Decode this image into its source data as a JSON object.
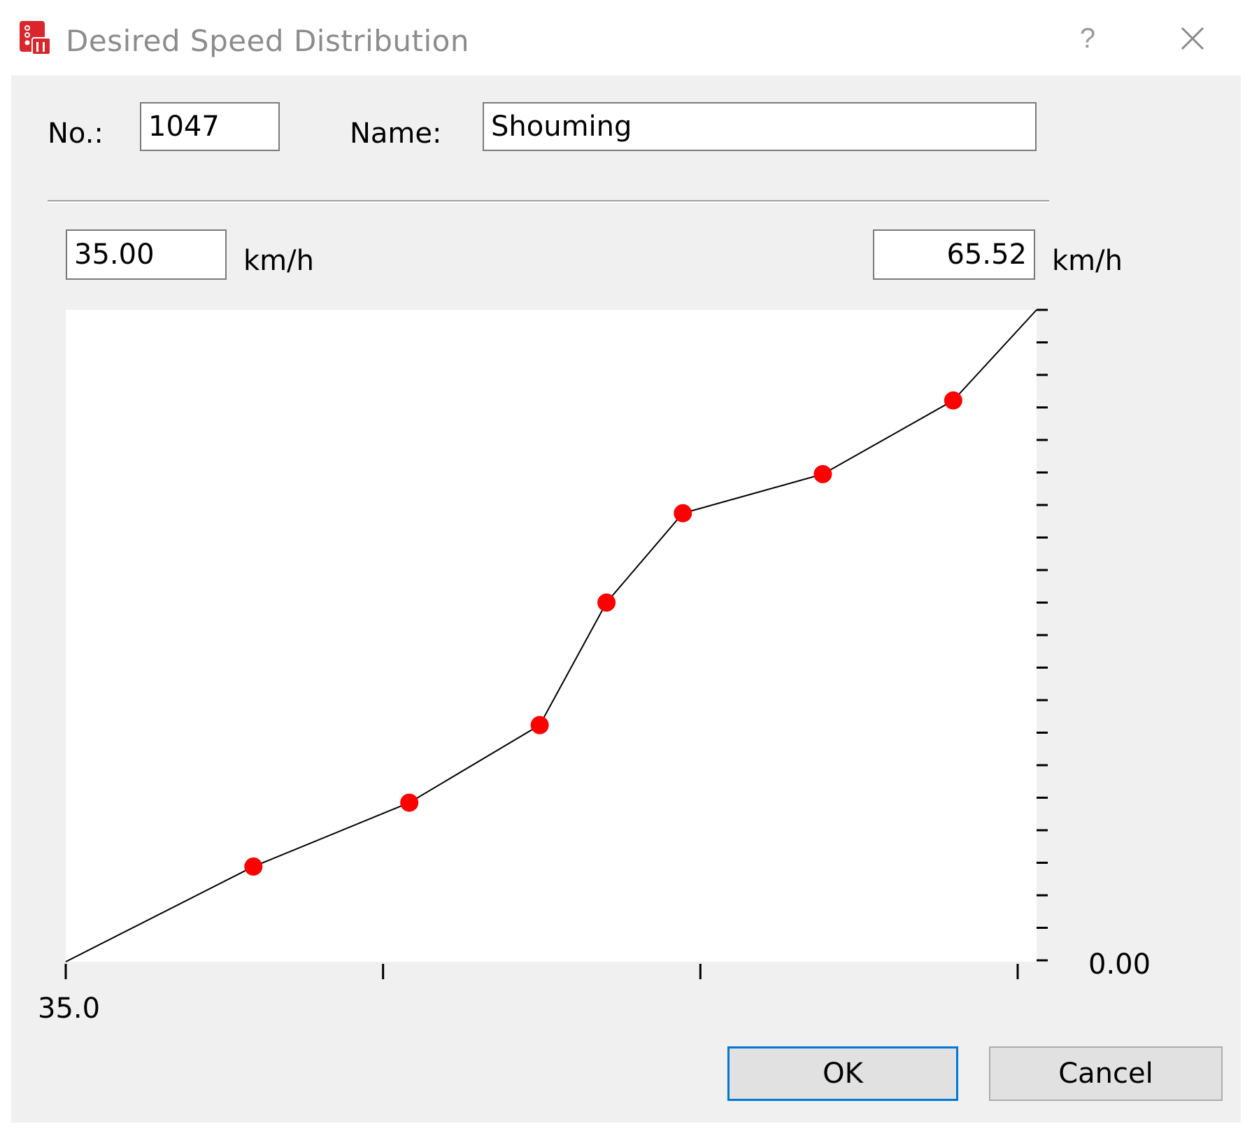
{
  "window": {
    "title": "Desired Speed Distribution",
    "help_glyph": "?",
    "icons": {
      "app": "vissim-app-icon",
      "close": "close-icon"
    }
  },
  "form": {
    "no_label": "No.:",
    "no_value": "1047",
    "name_label": "Name:",
    "name_value": "Shouming",
    "min_speed": "35.00",
    "max_speed": "65.52",
    "unit_min": "km/h",
    "unit_max": "km/h"
  },
  "chart_data": {
    "type": "line",
    "x_label_left": "35.0",
    "y_label_bottom": "0.00",
    "xlim": [
      35.0,
      65.52
    ],
    "ylim": [
      0,
      1
    ],
    "grid": false,
    "points": [
      {
        "x": 35.0,
        "y": 0.0,
        "marker": false
      },
      {
        "x": 40.9,
        "y": 0.146,
        "marker": true
      },
      {
        "x": 45.8,
        "y": 0.244,
        "marker": true
      },
      {
        "x": 49.9,
        "y": 0.363,
        "marker": true
      },
      {
        "x": 52.0,
        "y": 0.551,
        "marker": true
      },
      {
        "x": 54.4,
        "y": 0.688,
        "marker": true
      },
      {
        "x": 58.8,
        "y": 0.748,
        "marker": true
      },
      {
        "x": 62.9,
        "y": 0.861,
        "marker": true
      },
      {
        "x": 65.52,
        "y": 1.0,
        "marker": false
      }
    ],
    "line_color": "#000000",
    "marker_color": "#ff0000",
    "x_tick_count": 4,
    "y_tick_count": 21
  },
  "buttons": {
    "ok": "OK",
    "cancel": "Cancel"
  },
  "colors": {
    "accent": "#0078d7",
    "dialog_bg": "#f0f0f0",
    "app_icon": "#d9262c"
  }
}
